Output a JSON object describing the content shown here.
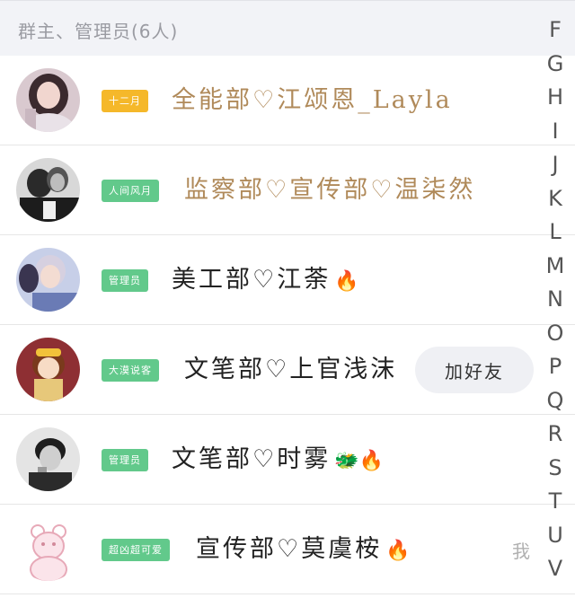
{
  "section": {
    "title": "群主、管理员(6人)"
  },
  "members": [
    {
      "badge": "十二月",
      "badge_color": "#f5b82a",
      "name": "全能部♡江颂恩_Layla",
      "name_color": "#b08a5a",
      "emoji": "",
      "avatar_icon": "woman-portrait-avatar"
    },
    {
      "badge": "人间风月",
      "badge_color": "#62c98b",
      "name": "监察部♡宣传部♡温柒然",
      "name_color": "#b08a5a",
      "emoji": "",
      "avatar_icon": "bw-couple-avatar"
    },
    {
      "badge": "管理员",
      "badge_color": "#62c98b",
      "name": "美工部♡江荼",
      "name_color": "#222222",
      "emoji": "🔥",
      "avatar_icon": "idol-avatar"
    },
    {
      "badge": "大漠说客",
      "badge_color": "#62c98b",
      "name": "文笔部♡上官浅沫",
      "name_color": "#222222",
      "emoji": "",
      "avatar_icon": "cartoon-girl-avatar",
      "action": "加好友"
    },
    {
      "badge": "管理员",
      "badge_color": "#62c98b",
      "name": "文笔部♡时雾",
      "name_color": "#222222",
      "emoji": "🐲🔥",
      "avatar_icon": "bw-man-avatar"
    },
    {
      "badge": "超凶超可爱",
      "badge_color": "#62c98b",
      "name": "宣传部♡莫虞桉",
      "name_color": "#222222",
      "emoji": "🔥",
      "avatar_icon": "pink-bear-avatar",
      "me_label": "我"
    }
  ],
  "index_letters": [
    "F",
    "G",
    "H",
    "I",
    "J",
    "K",
    "L",
    "M",
    "N",
    "O",
    "P",
    "Q",
    "R",
    "S",
    "T",
    "U",
    "V"
  ]
}
